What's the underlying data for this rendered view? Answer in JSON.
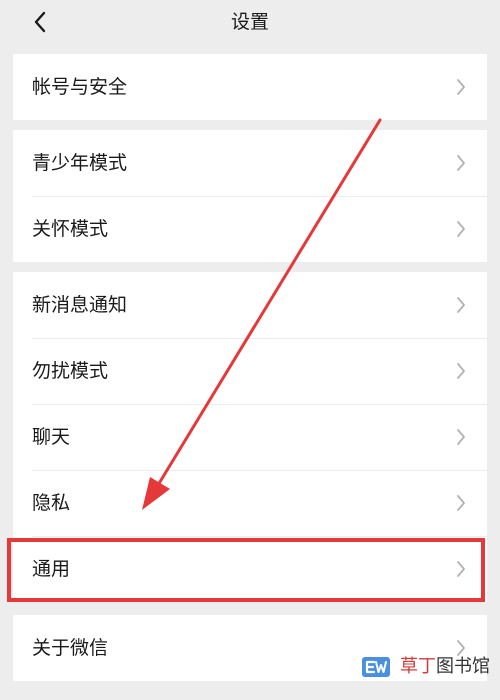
{
  "header": {
    "title": "设置",
    "back_icon": "chevron-left-icon"
  },
  "groups": [
    {
      "items": [
        {
          "label": "帐号与安全"
        }
      ]
    },
    {
      "items": [
        {
          "label": "青少年模式"
        },
        {
          "label": "关怀模式"
        }
      ]
    },
    {
      "items": [
        {
          "label": "新消息通知"
        },
        {
          "label": "勿扰模式"
        },
        {
          "label": "聊天"
        },
        {
          "label": "隐私"
        },
        {
          "label": "通用",
          "highlighted": true
        }
      ]
    },
    {
      "items": [
        {
          "label": "关于微信"
        }
      ]
    }
  ],
  "annotation": {
    "highlight_color": "#e53838",
    "arrow_color": "#e53838"
  },
  "watermark": {
    "logo_icon": "ew-logo-icon",
    "text_accent": "草丁",
    "text_rest": "图书馆"
  },
  "colors": {
    "background": "#ededed",
    "card": "#ffffff",
    "text": "#1a1a1a",
    "chevron": "#b2b2b2"
  }
}
